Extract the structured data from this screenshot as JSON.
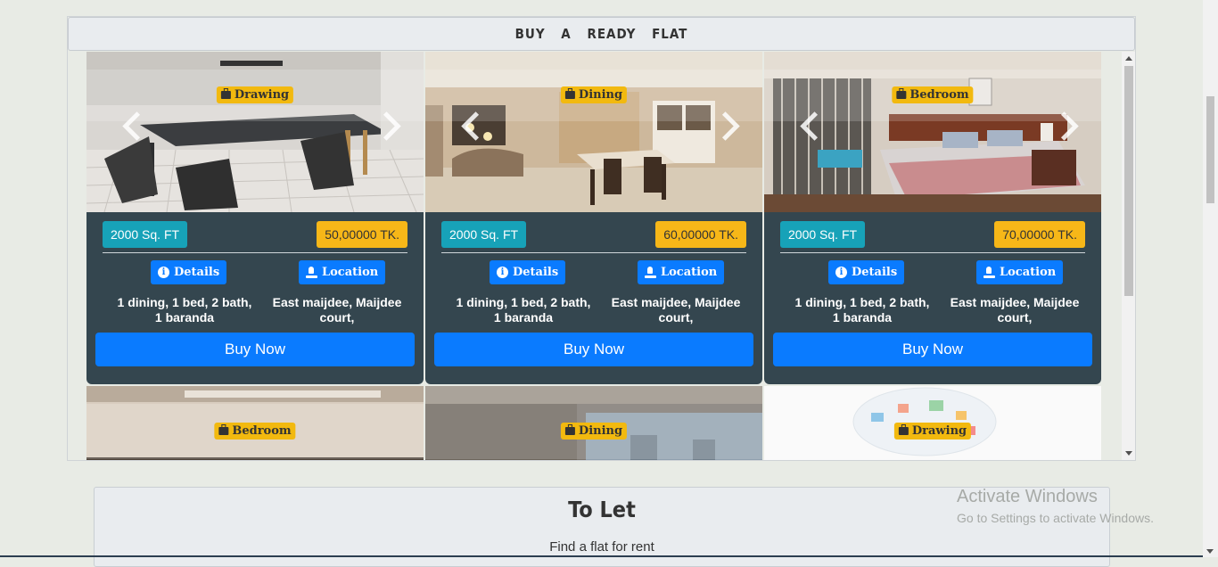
{
  "buy_section": {
    "title": "BUY A READY FLAT",
    "cards": [
      {
        "category": "Drawing",
        "area": "2000 Sq. FT",
        "price": "50,00000 TK.",
        "details_label": "Details",
        "location_label": "Location",
        "rooms": "1 dining, 1 bed, 2 bath, 1 baranda",
        "address": "East maijdee, Maijdee court,",
        "buy_label": "Buy Now"
      },
      {
        "category": "Dining",
        "area": "2000 Sq. FT",
        "price": "60,00000 TK.",
        "details_label": "Details",
        "location_label": "Location",
        "rooms": "1 dining, 1 bed, 2 bath, 1 baranda",
        "address": "East maijdee, Maijdee court,",
        "buy_label": "Buy Now"
      },
      {
        "category": "Bedroom",
        "area": "2000 Sq. FT",
        "price": "70,00000 TK.",
        "details_label": "Details",
        "location_label": "Location",
        "rooms": "1 dining, 1 bed, 2 bath, 1 baranda",
        "address": "East maijdee, Maijdee court,",
        "buy_label": "Buy Now"
      }
    ],
    "next_row": [
      {
        "category": "Bedroom"
      },
      {
        "category": "Dining"
      },
      {
        "category": "Drawing"
      }
    ]
  },
  "to_let": {
    "title": "To Let",
    "subtitle": "Find a flat for rent"
  },
  "watermark": {
    "line1": "Activate Windows",
    "line2": "Go to Settings to activate Windows."
  },
  "icons": [
    "briefcase-icon",
    "info-icon",
    "location-icon",
    "chevron-left-icon",
    "chevron-right-icon"
  ]
}
